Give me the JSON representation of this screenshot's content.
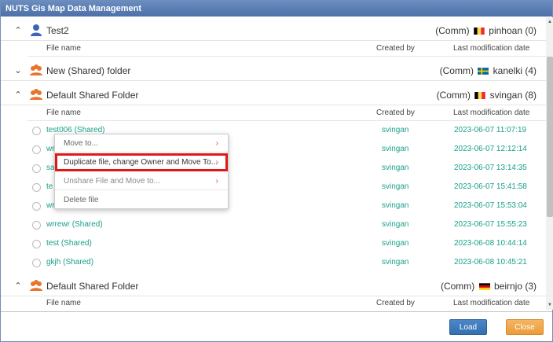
{
  "window": {
    "title": "NUTS Gis Map Data Management"
  },
  "columns": {
    "file_name": "File name",
    "created_by": "Created by",
    "last_mod": "Last modification date"
  },
  "folders": [
    {
      "name": "Test2",
      "owner": "(Comm)",
      "user": "pinhoan (0)",
      "expanded": true,
      "icon": "user-icon",
      "flag": "belgium"
    },
    {
      "name": "New (Shared) folder",
      "owner": "(Comm)",
      "user": "kanelki (4)",
      "expanded": false,
      "icon": "group-icon",
      "flag": "sweden"
    },
    {
      "name": "Default Shared Folder",
      "owner": "(Comm)",
      "user": "svingan (8)",
      "expanded": true,
      "icon": "group-icon",
      "flag": "belgium"
    },
    {
      "name": "Default Shared Folder",
      "owner": "(Comm)",
      "user": "beirnjo (3)",
      "expanded": true,
      "icon": "group-icon",
      "flag": "germany"
    }
  ],
  "files": [
    {
      "name": "test006 (Shared)",
      "by": "svingan",
      "date": "2023-06-07 11:07:19"
    },
    {
      "name": "wr",
      "by": "svingan",
      "date": "2023-06-07 12:12:14"
    },
    {
      "name": "sa",
      "by": "svingan",
      "date": "2023-06-07 13:14:35"
    },
    {
      "name": "te",
      "by": "svingan",
      "date": "2023-06-07 15:41:58"
    },
    {
      "name": "wr",
      "by": "svingan",
      "date": "2023-06-07 15:53:04"
    },
    {
      "name": "wrrewr (Shared)",
      "by": "svingan",
      "date": "2023-06-07 15:55:23"
    },
    {
      "name": "test (Shared)",
      "by": "svingan",
      "date": "2023-06-08 10:44:14"
    },
    {
      "name": "gkjh (Shared)",
      "by": "svingan",
      "date": "2023-06-08 10:45:21"
    }
  ],
  "context_menu": {
    "move_to": "Move to...",
    "duplicate": "Duplicate file, change Owner and Move To...",
    "unshare": "Unshare File and Move to...",
    "delete": "Delete file"
  },
  "buttons": {
    "load": "Load",
    "close": "Close"
  },
  "colors": {
    "title_bar": "#4c70a8",
    "file_text": "#1aa08a",
    "highlight": "#e01818",
    "load": "#346fb0",
    "close": "#ec9b3a"
  }
}
